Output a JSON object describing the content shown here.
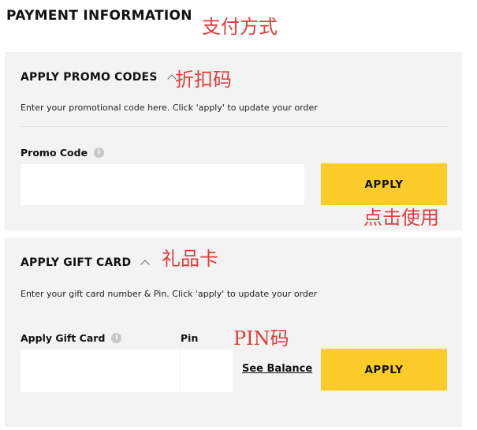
{
  "header": {
    "title": "PAYMENT INFORMATION",
    "annotation": "支付方式"
  },
  "promo": {
    "heading": "APPLY PROMO CODES",
    "annotation": "折扣码",
    "description": "Enter your promotional code here. Click 'apply' to update your order",
    "field_label": "Promo Code",
    "field_value": "",
    "info_icon": "info-icon",
    "apply_label": "APPLY",
    "apply_annotation": "点击使用"
  },
  "gift": {
    "heading": "APPLY GIFT CARD",
    "annotation": "礼品卡",
    "description": "Enter your gift card number & Pin. Click 'apply' to update your order",
    "card_label": "Apply Gift Card",
    "card_value": "",
    "pin_label": "Pin",
    "pin_value": "",
    "pin_annotation": "PIN码",
    "see_balance": "See Balance",
    "apply_label": "APPLY"
  },
  "colors": {
    "panel_bg": "#f3f3f3",
    "button_bg": "#fccd2a",
    "annotation": "#e33b3b"
  }
}
